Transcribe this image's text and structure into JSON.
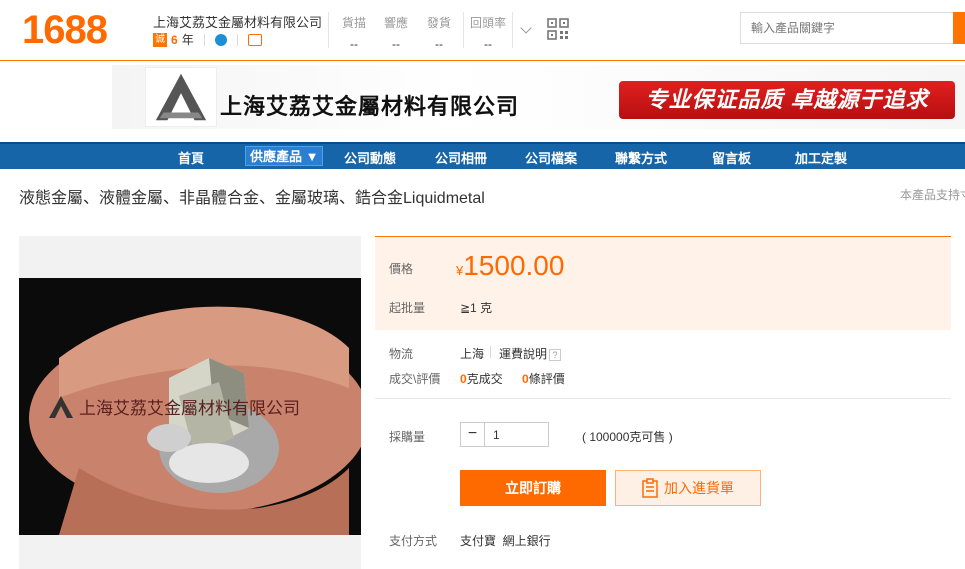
{
  "topbar": {
    "logo": "1688",
    "shop_name": "上海艾荔艾金屬材料有限公司",
    "cheng_badge": "诚",
    "years": "6",
    "years_unit": "年",
    "metrics": [
      {
        "label": "貨描",
        "value": "--"
      },
      {
        "label": "響應",
        "value": "--"
      },
      {
        "label": "發貨",
        "value": "--"
      },
      {
        "label": "回頭率",
        "value": "--"
      }
    ],
    "search_placeholder": "輸入產品關鍵字"
  },
  "banner": {
    "company_name": "上海艾荔艾金屬材料有限公司",
    "slogan": "专业保证品质  卓越源于追求"
  },
  "nav": {
    "items": [
      "首頁",
      "供應產品 ▼",
      "公司動態",
      "公司相冊",
      "公司檔案",
      "聯繫方式",
      "留言板",
      "加工定製"
    ]
  },
  "product": {
    "title": "液態金屬、液體金屬、非晶體合金、金屬玻璃、鋯合金Liquidmetal",
    "support_text": "本產品支持寸",
    "watermark": "上海艾荔艾金屬材料有限公司",
    "price_label": "價格",
    "currency": "¥",
    "price": "1500.00",
    "moq_label": "起批量",
    "moq_value": "≧1 克",
    "logistics_label": "物流",
    "logistics_from": "上海",
    "logistics_fee": "運費說明",
    "deal_label": "成交\\評價",
    "deals_count": "0",
    "deals_unit": "克成交",
    "reviews_count": "0",
    "reviews_unit": "條評價",
    "purchase_label": "採購量",
    "qty_minus": "−",
    "quantity": "1",
    "stock": "( 100000克可售 )",
    "buy_label": "立即訂購",
    "cart_label": "加入進貨單",
    "payment_label": "支付方式",
    "payment_methods": "支付寶  網上銀行"
  }
}
